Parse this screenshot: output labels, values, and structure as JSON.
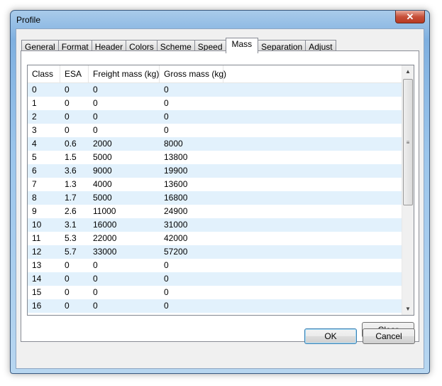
{
  "window": {
    "title": "Profile",
    "close_icon": "close-icon"
  },
  "tabs": [
    {
      "label": "General"
    },
    {
      "label": "Format"
    },
    {
      "label": "Header"
    },
    {
      "label": "Colors"
    },
    {
      "label": "Scheme"
    },
    {
      "label": "Speed"
    },
    {
      "label": "Mass",
      "active": true
    },
    {
      "label": "Separation"
    },
    {
      "label": "Adjust"
    }
  ],
  "table": {
    "columns": [
      "Class",
      "ESA",
      "Freight mass (kg)",
      "Gross mass (kg)"
    ],
    "rows": [
      [
        "0",
        "0",
        "0",
        "0"
      ],
      [
        "1",
        "0",
        "0",
        "0"
      ],
      [
        "2",
        "0",
        "0",
        "0"
      ],
      [
        "3",
        "0",
        "0",
        "0"
      ],
      [
        "4",
        "0.6",
        "2000",
        "8000"
      ],
      [
        "5",
        "1.5",
        "5000",
        "13800"
      ],
      [
        "6",
        "3.6",
        "9000",
        "19900"
      ],
      [
        "7",
        "1.3",
        "4000",
        "13600"
      ],
      [
        "8",
        "1.7",
        "5000",
        "16800"
      ],
      [
        "9",
        "2.6",
        "11000",
        "24900"
      ],
      [
        "10",
        "3.1",
        "16000",
        "31000"
      ],
      [
        "11",
        "5.3",
        "22000",
        "42000"
      ],
      [
        "12",
        "5.7",
        "33000",
        "57200"
      ],
      [
        "13",
        "0",
        "0",
        "0"
      ],
      [
        "14",
        "0",
        "0",
        "0"
      ],
      [
        "15",
        "0",
        "0",
        "0"
      ],
      [
        "16",
        "0",
        "0",
        "0"
      ]
    ]
  },
  "buttons": {
    "clear": "Clear",
    "ok": "OK",
    "cancel": "Cancel"
  }
}
